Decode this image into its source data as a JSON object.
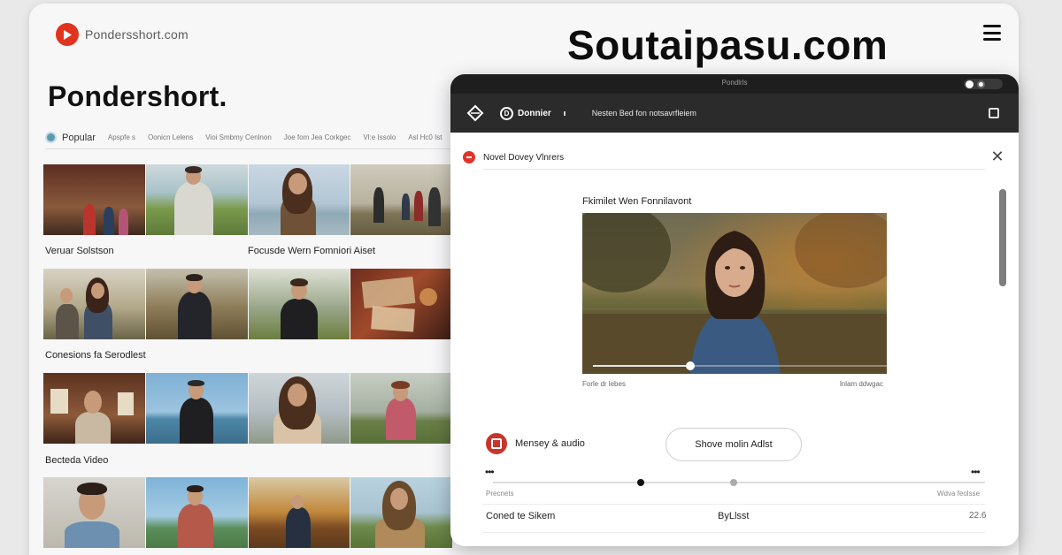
{
  "site": {
    "domain": "Pondersshort.com",
    "headline": "Soutaipasu.com",
    "heading": "Pondershort."
  },
  "filters": {
    "main": "Popular",
    "items": [
      "Apspfe s",
      "Oonicn Lelens",
      "Vioi Smbmy Cenlnon",
      "Joe fom Jea Corkgec",
      "Vl:e Issolo",
      "Asl Hc0 Ist"
    ]
  },
  "row_labels": [
    "Veruar Solstson",
    "Focusde Wern Fomniori Aiset",
    "Conesions fa Serodlest",
    "Becteda Video"
  ],
  "modal": {
    "topbar_text": "Pondlrls",
    "user_initial": "D",
    "user_name": "Donnier",
    "toolbar_title": "Nesten Bed fon notsavrfleiem",
    "header_title": "Novel Dovey Vlnrers",
    "video_caption": "Fkimilet Wen Fonnilavont",
    "video_meta_left": "Forle dr lebes",
    "video_meta_right": "lnlam ddwgac",
    "audio_label": "Mensey & audio",
    "show_button": "Shove molin Adlst",
    "progress_left": "Precnets",
    "progress_right": "Wdva feolsse",
    "footer_left": "Coned te Sikem",
    "footer_mid": "ByLlsst",
    "footer_right": "22.6",
    "playback_fraction": 0.33
  },
  "colors": {
    "brand_red": "#e0341f",
    "dark_toolbar": "#2b2b2b",
    "accent_teal": "#5a9bb0"
  }
}
